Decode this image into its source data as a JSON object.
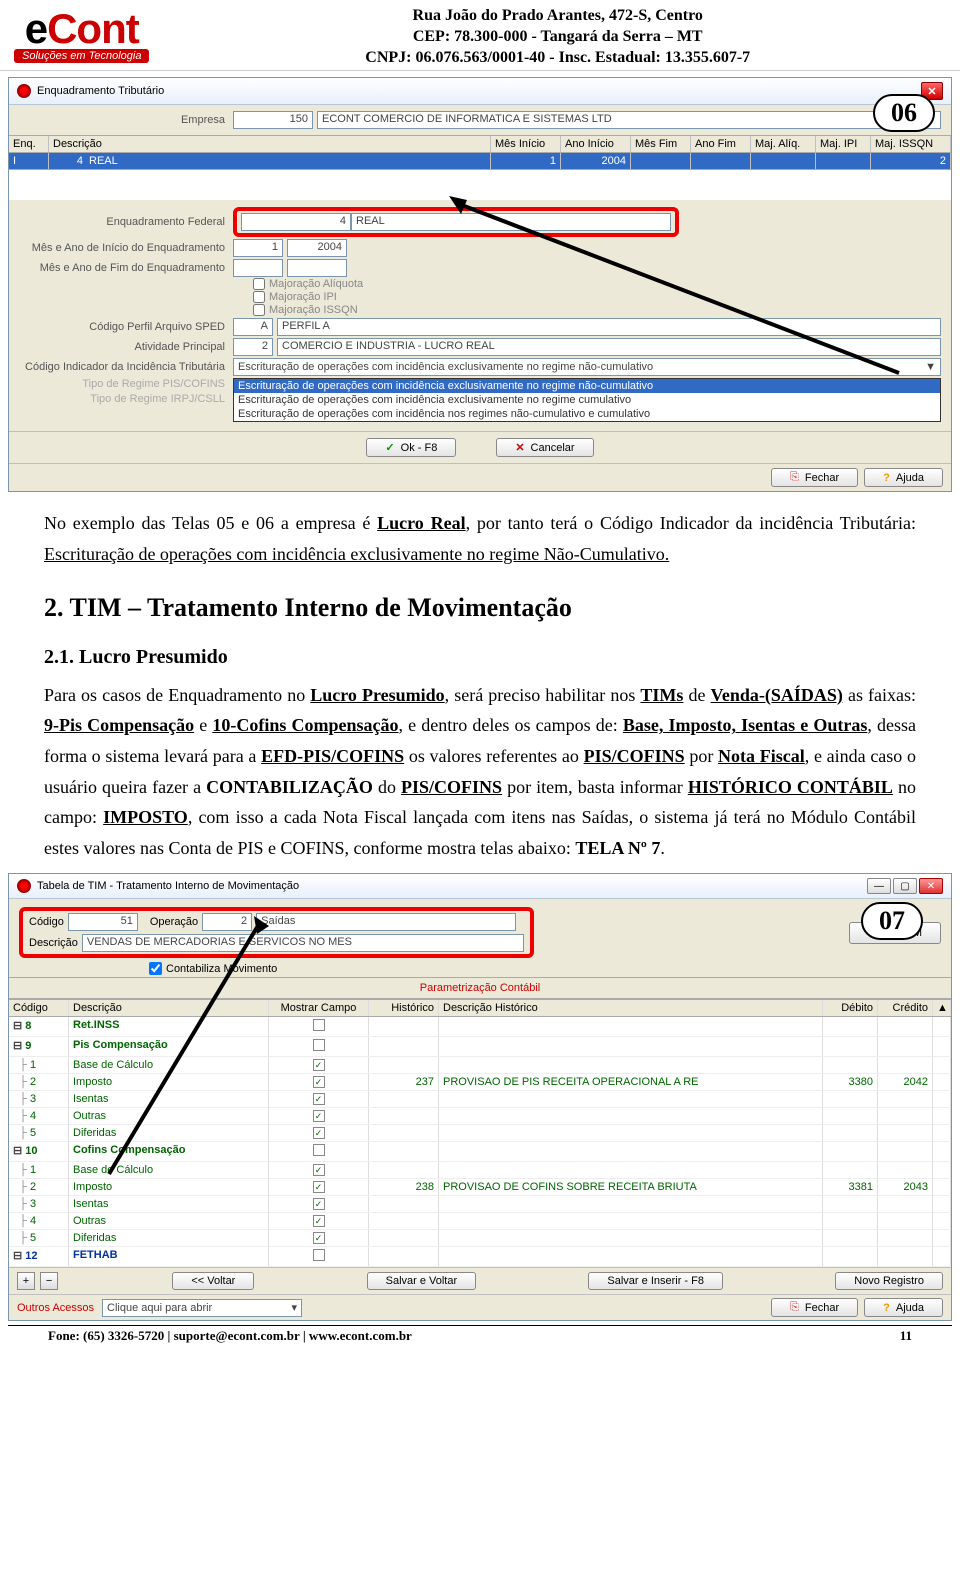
{
  "header": {
    "logo_main": "eCont",
    "logo_tag": "Soluções em Tecnologia",
    "line1": "Rua João do Prado Arantes, 472-S, Centro",
    "line2": "CEP: 78.300-000  -  Tangará da Serra – MT",
    "line3": "CNPJ: 06.076.563/0001-40  -  Insc. Estadual: 13.355.607-7"
  },
  "ss1": {
    "title": "Enquadramento Tributário",
    "empresa_label": "Empresa",
    "empresa_cod": "150",
    "empresa_nome": "ECONT COMERCIO DE INFORMATICA E SISTEMAS LTD",
    "cols": {
      "enq": "Enq.",
      "desc": "Descrição",
      "mi": "Mês Início",
      "ai": "Ano Início",
      "mf": "Mês Fim",
      "af": "Ano Fim",
      "maj": "Maj. Alíq.",
      "mip": "Maj. IPI",
      "miq": "Maj. ISSQN"
    },
    "row": {
      "enq": "I",
      "cod": "4",
      "desc": "REAL",
      "mi": "1",
      "ai": "2004",
      "miq": "2"
    },
    "labels": {
      "enq_fed": "Enquadramento Federal",
      "mes_ini": "Mês e Ano de Início do Enquadramento",
      "mes_fim": "Mês e Ano de Fim do Enquadramento",
      "maj_aliq": "Majoração Alíquota",
      "maj_ipi": "Majoração IPI",
      "maj_issqn": "Majoração ISSQN",
      "cod_perfil": "Código Perfil Arquivo SPED",
      "ativ": "Atividade Principal",
      "cod_inc": "Código Indicador da Incidência Tributária",
      "tipo_pis": "Tipo de Regime PIS/COFINS",
      "tipo_irpj": "Tipo de Regime IRPJ/CSLL"
    },
    "vals": {
      "enq_fed_cod": "4",
      "enq_fed_txt": "REAL",
      "mes_ini_m": "1",
      "mes_ini_a": "2004",
      "perfil_cod": "A",
      "perfil_txt": "PERFIL A",
      "ativ_cod": "2",
      "ativ_txt": "COMERCIO E INDUSTRIA - LUCRO REAL",
      "inc_txt": "Escrituração de operações com incidência exclusivamente no regime não-cumulativo"
    },
    "dropdown": [
      "Escrituração de operações com incidência exclusivamente no regime não-cumulativo",
      "Escrituração de operações com incidência exclusivamente no regime cumulativo",
      "Escrituração de operações com incidência nos regimes não-cumulativo e cumulativo"
    ],
    "ok": "Ok - F8",
    "cancel": "Cancelar",
    "fechar": "Fechar",
    "ajuda": "Ajuda",
    "callout": "06"
  },
  "body": {
    "p1a": "No exemplo das Telas 05 e 06 a empresa é ",
    "p1b": "Lucro Real",
    "p1c": ", por tanto terá o Código Indicador da incidência Tributária: ",
    "p1d": "Escrituração de operações com incidência exclusivamente no regime Não-Cumulativo.",
    "h2": "2. TIM – Tratamento Interno de Movimentação",
    "h3": "2.1. Lucro Presumido",
    "p2a": "Para os casos de Enquadramento no ",
    "p2b": "Lucro Presumido",
    "p2c": ", será preciso habilitar nos ",
    "p2d": "TIMs",
    "p2e": " de ",
    "p2f": "Venda-(SAÍDAS)",
    "p2g": " as faixas: ",
    "p2h": "9-Pis Compensação",
    "p2i": " e ",
    "p2j": "10-Cofins Compensação",
    "p2k": ", e dentro deles os campos de: ",
    "p2l": "Base, Imposto, Isentas e Outras",
    "p2m": ", dessa forma o sistema levará para a ",
    "p2n": "EFD-PIS/COFINS",
    "p2o": " os valores referentes ao ",
    "p2p": "PIS/COFINS",
    "p2q": " por ",
    "p2r": "Nota Fiscal",
    "p2s": ", e ainda caso o usuário queira fazer a ",
    "p2t": "CONTABILIZAÇÃO",
    "p2u": " do ",
    "p2v": "PIS/COFINS",
    "p2w": " por item, basta informar ",
    "p2x": "HISTÓRICO CONTÁBIL",
    "p2y": " no campo: ",
    "p2z": "IMPOSTO",
    "p2aa": ", com isso a cada Nota Fiscal lançada com itens nas Saídas, o sistema já terá no Módulo Contábil estes valores nas Conta de PIS e COFINS, conforme mostra telas abaixo: ",
    "p2ab": "TELA Nº 7",
    "p2ac": "."
  },
  "ss2": {
    "title": "Tabela de TIM - Tratamento Interno de Movimentação",
    "codigo_lbl": "Código",
    "codigo_val": "51",
    "oper_lbl": "Operação",
    "oper_cod": "2",
    "oper_txt": "Saídas",
    "desc_lbl": "Descrição",
    "desc_val": "VENDAS DE MERCADORIAS E SERVICOS NO MES",
    "copiar": "Copiar TIM",
    "contab": "Contabiliza Movimento",
    "param": "Parametrização Contábil",
    "cols": {
      "cod": "Código",
      "desc": "Descrição",
      "mc": "Mostrar Campo",
      "hist": "Histórico",
      "dh": "Descrição Histórico",
      "deb": "Débito",
      "cred": "Crédito"
    },
    "rows": [
      {
        "type": "parent",
        "code": "8",
        "desc": "Ret.INSS"
      },
      {
        "type": "parent",
        "code": "9",
        "desc": "Pis Compensação"
      },
      {
        "type": "child",
        "code": "1",
        "desc": "Base de Cálculo",
        "mc": true
      },
      {
        "type": "child",
        "code": "2",
        "desc": "Imposto",
        "mc": true,
        "hist": "237",
        "dh": "PROVISAO DE PIS RECEITA OPERACIONAL A RE",
        "deb": "3380",
        "cred": "2042"
      },
      {
        "type": "child",
        "code": "3",
        "desc": "Isentas",
        "mc": true
      },
      {
        "type": "child",
        "code": "4",
        "desc": "Outras",
        "mc": true
      },
      {
        "type": "child",
        "code": "5",
        "desc": "Diferidas",
        "mc": true
      },
      {
        "type": "parent",
        "code": "10",
        "desc": "Cofins Compensação"
      },
      {
        "type": "child",
        "code": "1",
        "desc": "Base de Cálculo",
        "mc": true
      },
      {
        "type": "child",
        "code": "2",
        "desc": "Imposto",
        "mc": true,
        "hist": "238",
        "dh": "PROVISAO DE COFINS SOBRE RECEITA BRIUTA",
        "deb": "3381",
        "cred": "2043"
      },
      {
        "type": "child",
        "code": "3",
        "desc": "Isentas",
        "mc": true
      },
      {
        "type": "child",
        "code": "4",
        "desc": "Outras",
        "mc": true
      },
      {
        "type": "child",
        "code": "5",
        "desc": "Diferidas",
        "mc": true
      },
      {
        "type": "blue",
        "code": "12",
        "desc": "FETHAB"
      }
    ],
    "voltar": "<< Voltar",
    "salvar_voltar": "Salvar e Voltar",
    "salvar_ins": "Salvar e Inserir - F8",
    "novo": "Novo Registro",
    "outros": "Outros Acessos",
    "clique": "Clique aqui para abrir",
    "fechar": "Fechar",
    "ajuda": "Ajuda",
    "callout": "07"
  },
  "footer": {
    "left": "Fone: (65) 3326-5720 | suporte@econt.com.br | www.econt.com.br",
    "right": "11"
  }
}
